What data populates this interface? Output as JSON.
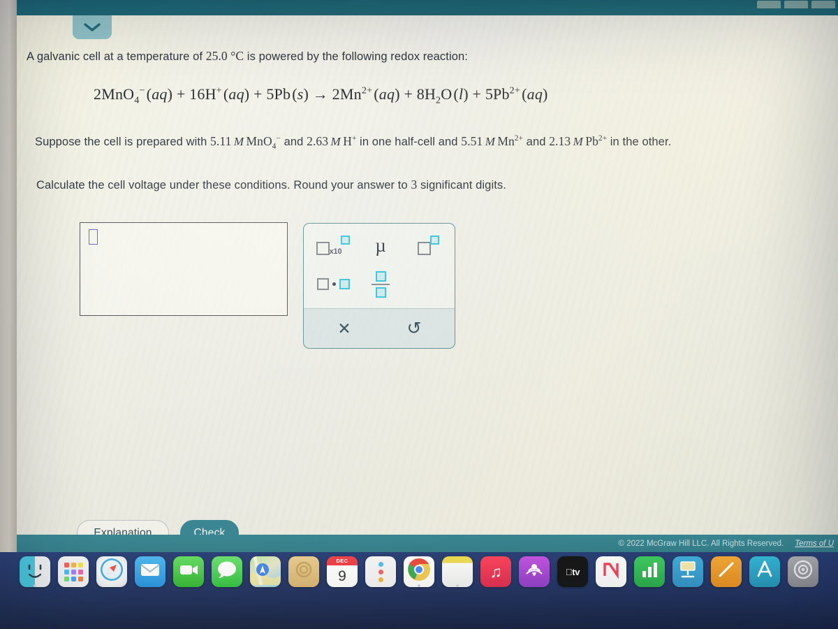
{
  "topbar": {
    "tab_stub_count": 3
  },
  "page": {
    "collapse_chevron": "chevron-down"
  },
  "question": {
    "line1_pre": "A galvanic cell at a temperature of ",
    "line1_temp": "25.0 °C",
    "line1_post": " is powered by the following redox reaction:",
    "equation_plain": "2MnO4- (aq) + 16H+ (aq) + 5Pb (s) -> 2Mn2+ (aq) + 8H2O (l) + 5Pb2+ (aq)",
    "line3_a": "Suppose the cell is prepared with ",
    "line3_c1": "5.11",
    "line3_m1": "M",
    "line3_sp1": "MnO",
    "line3_and1": " and ",
    "line3_c2": "2.63",
    "line3_m2": "M",
    "line3_sp2": "H",
    "line3_b": " in one half-cell and ",
    "line3_c3": "5.51",
    "line3_m3": "M",
    "line3_sp3": "Mn",
    "line3_and2": " and ",
    "line3_c4": "2.13",
    "line3_m4": "M",
    "line3_sp4": "Pb",
    "line3_end": " in the other.",
    "line4_a": "Calculate the cell voltage under these conditions. Round your answer to ",
    "line4_sig": "3",
    "line4_b": " significant digits."
  },
  "answer": {
    "value": "",
    "placeholder": ""
  },
  "palette": {
    "sci_notation": "x10",
    "micro": "µ",
    "superscript_label": "superscript",
    "multiply_label": "multiply",
    "fraction_label": "fraction",
    "clear_glyph": "✕",
    "undo_glyph": "↺"
  },
  "actions": {
    "explanation_label": "Explanation",
    "check_label": "Check"
  },
  "footer": {
    "copyright": "© 2022 McGraw Hill LLC. All Rights Reserved.",
    "terms": "Terms of U"
  },
  "colors": {
    "accent_teal": "#2d7d8e",
    "topbar_teal": "#0f5f70",
    "chevron_tab": "#8cc0c6",
    "palette_border": "#5a8b95",
    "cyan_square": "#2ec0d8",
    "input_border": "#4a4a52",
    "caret_blue": "#5a5fb0"
  },
  "dock": {
    "items": [
      {
        "name": "finder",
        "label": "Finder",
        "running": true
      },
      {
        "name": "launchpad",
        "label": "Launchpad",
        "running": false
      },
      {
        "name": "safari",
        "label": "Safari",
        "running": false
      },
      {
        "name": "mail",
        "label": "Mail",
        "running": false
      },
      {
        "name": "facetime",
        "label": "FaceTime",
        "running": false
      },
      {
        "name": "messages",
        "label": "Messages",
        "running": false
      },
      {
        "name": "maps",
        "label": "Maps",
        "running": false
      },
      {
        "name": "notes",
        "label": "Notes",
        "running": false
      },
      {
        "name": "calendar",
        "label": "Calendar",
        "running": false,
        "month": "DEC",
        "day": "9"
      },
      {
        "name": "contacts",
        "label": "Contacts",
        "running": false
      },
      {
        "name": "chrome",
        "label": "Google Chrome",
        "running": true
      },
      {
        "name": "reminders",
        "label": "Reminders",
        "running": true
      },
      {
        "name": "music",
        "label": "Music",
        "running": false
      },
      {
        "name": "podcasts",
        "label": "Podcasts",
        "running": false
      },
      {
        "name": "appletv",
        "label": "Apple TV",
        "running": false,
        "text": "tv"
      },
      {
        "name": "news",
        "label": "News",
        "running": false
      },
      {
        "name": "numbers",
        "label": "Numbers",
        "running": false
      },
      {
        "name": "keynote",
        "label": "Keynote",
        "running": false
      },
      {
        "name": "pages",
        "label": "Pages",
        "running": false
      },
      {
        "name": "appstore",
        "label": "App Store",
        "running": false
      },
      {
        "name": "settings",
        "label": "System Settings",
        "running": false
      }
    ]
  }
}
